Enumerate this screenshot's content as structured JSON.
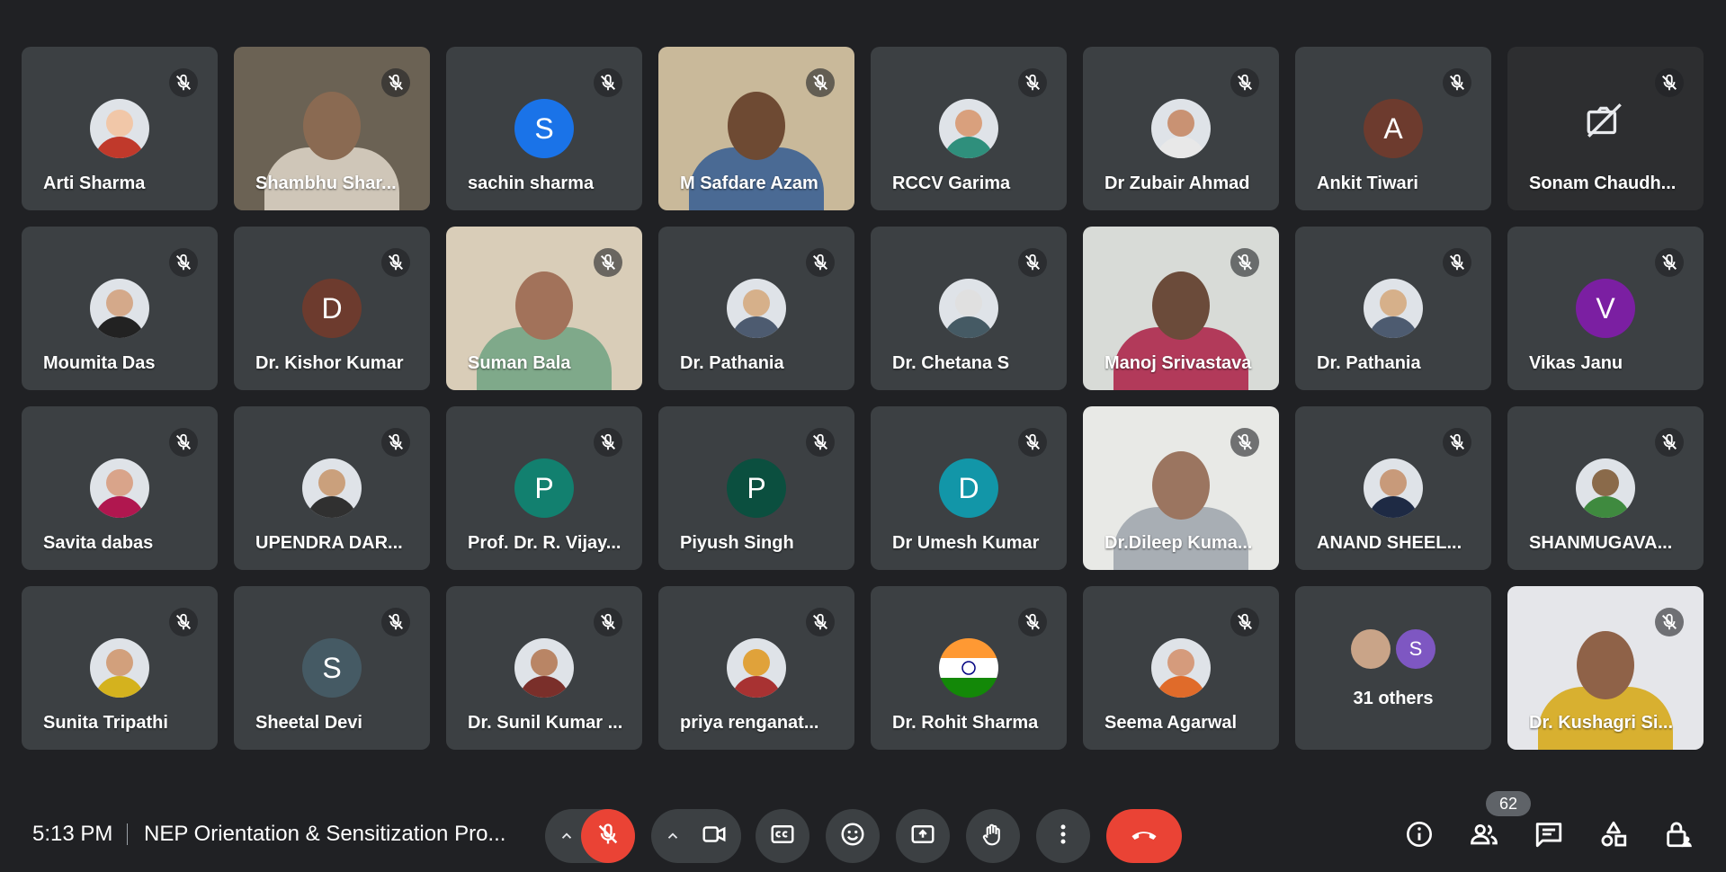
{
  "participants": [
    {
      "name": "Arti Sharma",
      "kind": "photo",
      "c1": "#f1c7a8",
      "c2": "#c0392b"
    },
    {
      "name": "Shambhu Shar...",
      "kind": "video",
      "bg": "#6b6254",
      "skin": "#8a6a52",
      "shirt": "#cfc6b8"
    },
    {
      "name": "sachin sharma",
      "kind": "letter",
      "letter": "S",
      "color": "#1a73e8"
    },
    {
      "name": "M Safdare Azam",
      "kind": "video",
      "bg": "#c9b99a",
      "skin": "#6e4a33",
      "shirt": "#4a6a94"
    },
    {
      "name": "RCCV Garima",
      "kind": "photo",
      "c1": "#d9a07d",
      "c2": "#2f8f7c"
    },
    {
      "name": "Dr Zubair Ahmad",
      "kind": "photo",
      "c1": "#c99273",
      "c2": "#e8e8e8"
    },
    {
      "name": "Ankit Tiwari",
      "kind": "letter",
      "letter": "A",
      "color": "#6d3b2e"
    },
    {
      "name": "Sonam Chaudh...",
      "kind": "camoff"
    },
    {
      "name": "Moumita Das",
      "kind": "photo",
      "c1": "#d4a98a",
      "c2": "#222222"
    },
    {
      "name": "Dr. Kishor Kumar",
      "kind": "letter",
      "letter": "D",
      "color": "#6d3b2e"
    },
    {
      "name": "Suman Bala",
      "kind": "video",
      "bg": "#d9cdb8",
      "skin": "#a2725a",
      "shirt": "#7fa98a"
    },
    {
      "name": "Dr. Pathania",
      "kind": "photo",
      "c1": "#d6b08a",
      "c2": "#4d5b70"
    },
    {
      "name": "Dr. Chetana S",
      "kind": "photo",
      "c1": "#e0e0e0",
      "c2": "#455a64"
    },
    {
      "name": "Manoj Srivastava",
      "kind": "video",
      "bg": "#d8dbd7",
      "skin": "#6b4b3a",
      "shirt": "#b23a5a"
    },
    {
      "name": "Dr. Pathania",
      "kind": "photo",
      "c1": "#d6b08a",
      "c2": "#4d5b70"
    },
    {
      "name": "Vikas Janu",
      "kind": "letter",
      "letter": "V",
      "color": "#7b1fa2"
    },
    {
      "name": "Savita dabas",
      "kind": "photo",
      "c1": "#d9a48a",
      "c2": "#b0174f"
    },
    {
      "name": "UPENDRA DAR...",
      "kind": "photo",
      "c1": "#caa07c",
      "c2": "#303030"
    },
    {
      "name": "Prof. Dr. R. Vijay...",
      "kind": "letter",
      "letter": "P",
      "color": "#12806f"
    },
    {
      "name": "Piyush Singh",
      "kind": "letter",
      "letter": "P",
      "color": "#0b4f3f"
    },
    {
      "name": "Dr Umesh Kumar",
      "kind": "letter",
      "letter": "D",
      "color": "#1296a8"
    },
    {
      "name": "Dr.Dileep Kuma...",
      "kind": "video",
      "bg": "#e8e9e6",
      "skin": "#9b7560",
      "shirt": "#a8aeb4"
    },
    {
      "name": "ANAND SHEEL...",
      "kind": "photo",
      "c1": "#c89a7a",
      "c2": "#1e2a44"
    },
    {
      "name": "SHANMUGAVA...",
      "kind": "photo",
      "c1": "#8a6a4a",
      "c2": "#3f8a3f"
    },
    {
      "name": "Sunita Tripathi",
      "kind": "photo",
      "c1": "#d2a07c",
      "c2": "#d4b21e"
    },
    {
      "name": "Sheetal Devi",
      "kind": "letter",
      "letter": "S",
      "color": "#455a64"
    },
    {
      "name": "Dr. Sunil Kumar ...",
      "kind": "photo",
      "c1": "#b98565",
      "c2": "#7a2f2a"
    },
    {
      "name": "priya renganat...",
      "kind": "photo",
      "c1": "#e0a23a",
      "c2": "#a83232"
    },
    {
      "name": "Dr. Rohit Sharma",
      "kind": "flag"
    },
    {
      "name": "Seema Agarwal",
      "kind": "photo",
      "c1": "#d59b7c",
      "c2": "#e06b2a"
    },
    {
      "name": "",
      "kind": "others",
      "label": "31 others",
      "letter": "S",
      "color": "#7e57c2"
    },
    {
      "name": "Dr. Kushagri Si...",
      "kind": "video",
      "bg": "#e5e6ea",
      "skin": "#8f6248",
      "shirt": "#d8b030"
    }
  ],
  "bottom_bar": {
    "time": "5:13 PM",
    "meeting_title": "NEP Orientation & Sensitization Pro...",
    "people_count": "62"
  },
  "colors": {
    "end_call": "#ea4335",
    "mic_off": "#ea4335",
    "tile": "#3c4043",
    "background": "#202124"
  }
}
